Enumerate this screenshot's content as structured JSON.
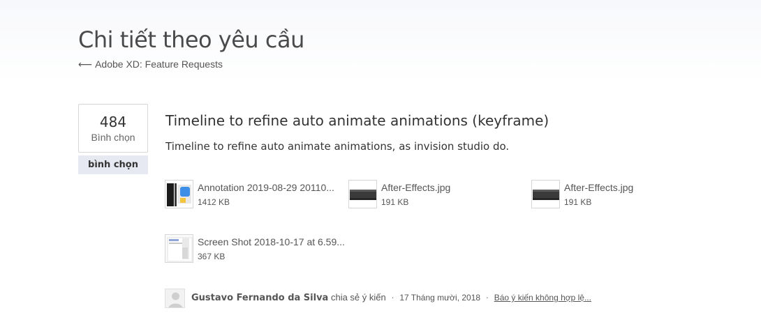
{
  "header": {
    "title": "Chi tiết theo yêu cầu",
    "back_arrow": "⟵",
    "back_label": "Adobe XD: Feature Requests"
  },
  "vote": {
    "count": "484",
    "count_label": "Bình chọn",
    "button_label": "bình chọn"
  },
  "idea": {
    "title": "Timeline to refine auto animate animations (keyframe)",
    "description": "Timeline to refine auto animate animations, as invision studio do."
  },
  "attachments": [
    {
      "name": "Annotation 2019-08-29 20110...",
      "size": "1412 KB",
      "thumb_icon": "annotation-thumbnail"
    },
    {
      "name": "After-Effects.jpg",
      "size": "191 KB",
      "thumb_icon": "after-effects-thumbnail"
    },
    {
      "name": "After-Effects.jpg",
      "size": "191 KB",
      "thumb_icon": "after-effects-thumbnail"
    },
    {
      "name": "Screen Shot 2018-10-17 at 6.59...",
      "size": "367 KB",
      "thumb_icon": "screenshot-thumbnail"
    }
  ],
  "comment": {
    "author": "Gustavo Fernando da Silva",
    "action": "chia sẻ ý kiến",
    "separator": "·",
    "date": "17 Tháng mười, 2018",
    "report_label": "Báo ý kiến không hợp lệ..."
  },
  "colors": {
    "vote_button_bg": "#e6e9f1",
    "text_primary": "#333333",
    "text_secondary": "#555555",
    "border": "#d6d6d6"
  }
}
